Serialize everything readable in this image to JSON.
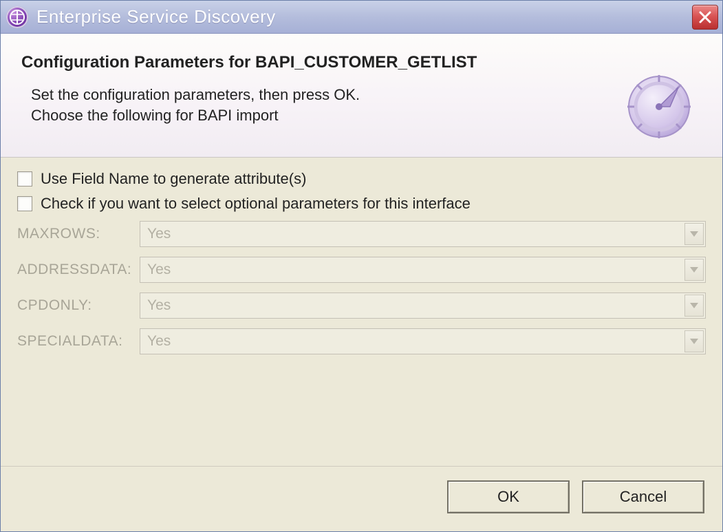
{
  "window": {
    "title": "Enterprise Service Discovery"
  },
  "header": {
    "title": "Configuration Parameters for BAPI_CUSTOMER_GETLIST",
    "desc_line1": "Set the configuration parameters, then press OK.",
    "desc_line2": "Choose the following for BAPI import"
  },
  "form": {
    "checkboxes": [
      {
        "label": "Use Field Name to generate attribute(s)",
        "checked": false
      },
      {
        "label": "Check if you want to select optional parameters for this interface",
        "checked": false
      }
    ],
    "params": [
      {
        "label": "MAXROWS:",
        "value": "Yes",
        "enabled": false
      },
      {
        "label": "ADDRESSDATA:",
        "value": "Yes",
        "enabled": false
      },
      {
        "label": "CPDONLY:",
        "value": "Yes",
        "enabled": false
      },
      {
        "label": "SPECIALDATA:",
        "value": "Yes",
        "enabled": false
      }
    ]
  },
  "buttons": {
    "ok": "OK",
    "cancel": "Cancel"
  }
}
